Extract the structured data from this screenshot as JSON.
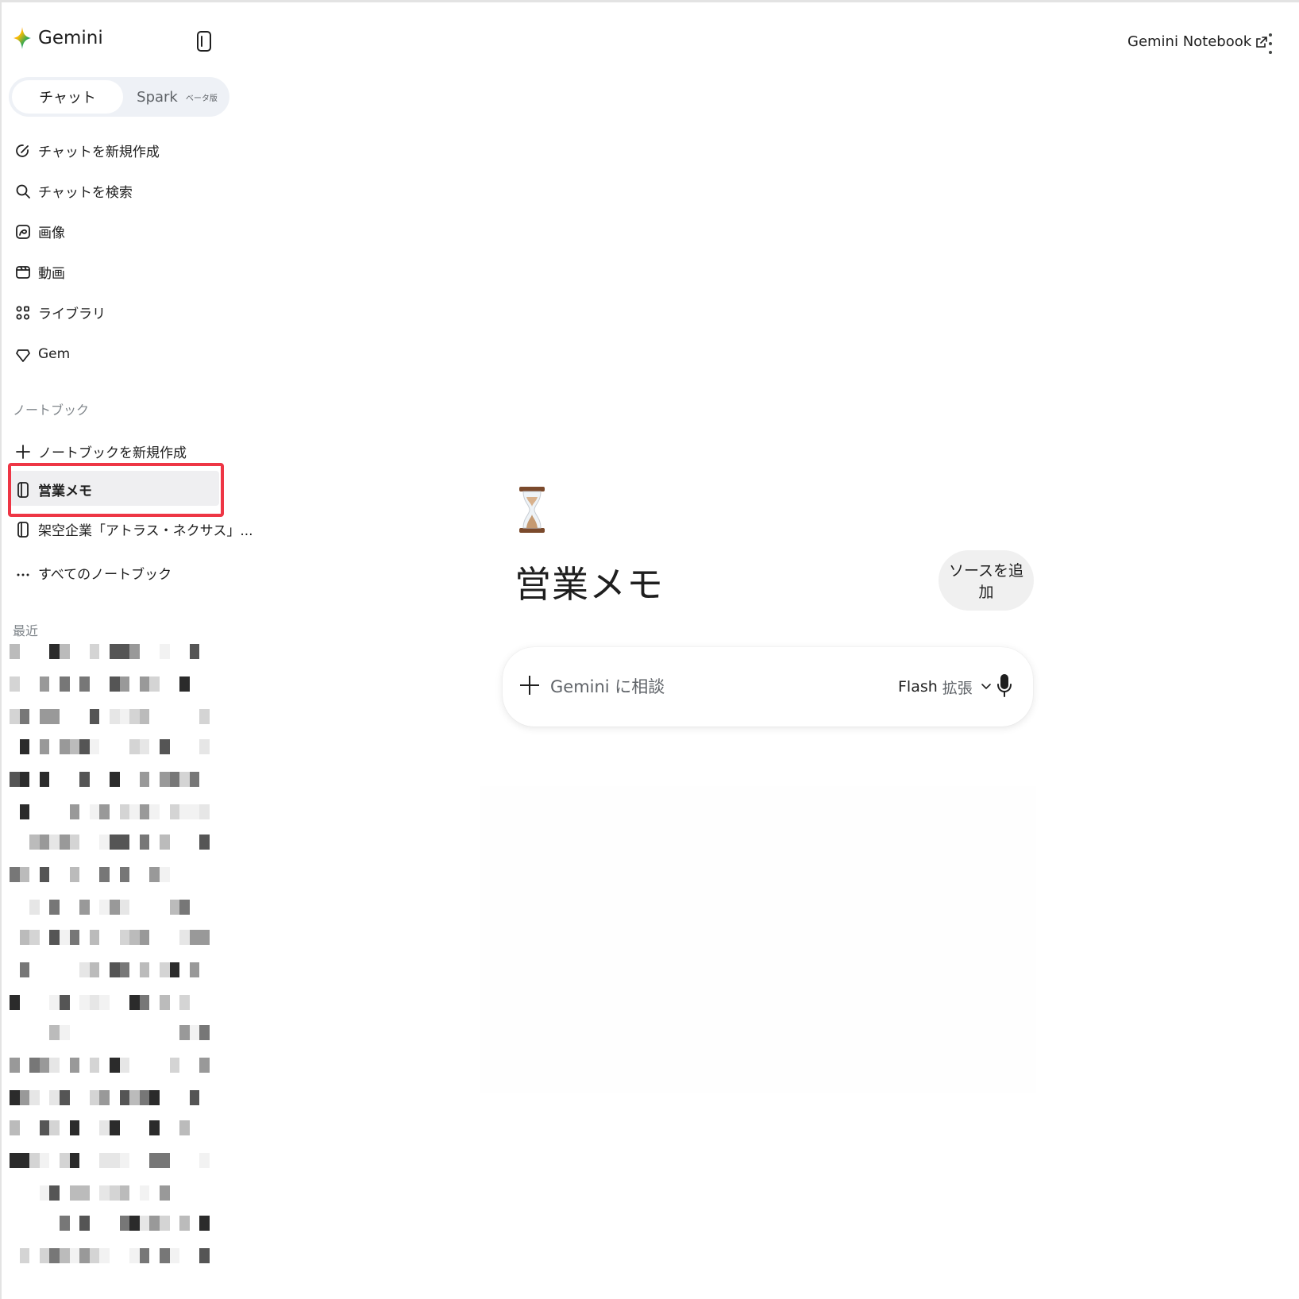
{
  "app": {
    "name": "Gemini"
  },
  "modes": {
    "chat": "チャット",
    "spark": "Spark",
    "beta": "ベータ版"
  },
  "nav": [
    {
      "label": "チャットを新規作成",
      "icon": "new-chat-icon"
    },
    {
      "label": "チャットを検索",
      "icon": "search-icon"
    },
    {
      "label": "画像",
      "icon": "image-icon"
    },
    {
      "label": "動画",
      "icon": "video-icon"
    },
    {
      "label": "ライブラリ",
      "icon": "library-icon"
    },
    {
      "label": "Gem",
      "icon": "gem-icon"
    }
  ],
  "notebooks": {
    "section": "ノートブック",
    "new_label": "ノートブックを新規作成",
    "items": [
      {
        "label": "営業メモ",
        "selected": true
      },
      {
        "label": "架空企業「アトラス・ネクサス」..."
      }
    ],
    "all_label": "すべてのノートブック"
  },
  "recent": {
    "section": "最近"
  },
  "header": {
    "notebook_link": "Gemini Notebook"
  },
  "main": {
    "emoji": "hourglass",
    "title": "営業メモ",
    "add_source": "ソースを追加",
    "prompt_placeholder": "Gemini に相談",
    "model": "Flash",
    "model_mode": "拡張"
  },
  "colors": {
    "highlight": "#ee3645",
    "sidebar_selected": "#efeff1",
    "chip": "#f0f0f0"
  }
}
